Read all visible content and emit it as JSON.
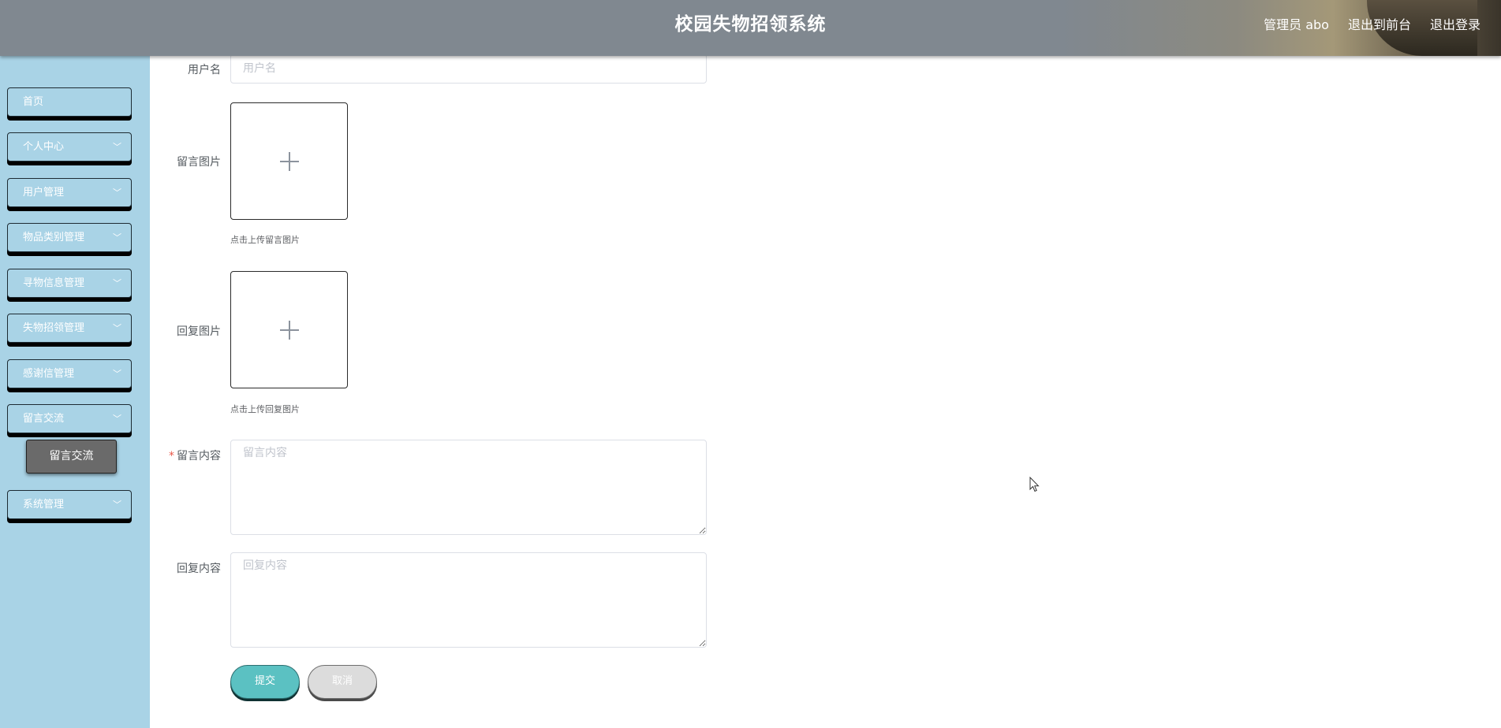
{
  "header": {
    "title": "校园失物招领系统",
    "admin_label": "管理员 abo",
    "front_link": "退出到前台",
    "logout_link": "退出登录"
  },
  "sidebar": {
    "items": [
      {
        "label": "首页",
        "has_chevron": false
      },
      {
        "label": "个人中心",
        "has_chevron": true
      },
      {
        "label": "用户管理",
        "has_chevron": true
      },
      {
        "label": "物品类别管理",
        "has_chevron": true
      },
      {
        "label": "寻物信息管理",
        "has_chevron": true
      },
      {
        "label": "失物招领管理",
        "has_chevron": true
      },
      {
        "label": "感谢信管理",
        "has_chevron": true
      },
      {
        "label": "留言交流",
        "has_chevron": true
      },
      {
        "label": "系统管理",
        "has_chevron": true
      }
    ],
    "active_submenu": "留言交流",
    "chevron_glyph": "﹀"
  },
  "form": {
    "username_label": "用户名",
    "username_placeholder": "用户名",
    "message_image_label": "留言图片",
    "message_image_hint": "点击上传留言图片",
    "reply_image_label": "回复图片",
    "reply_image_hint": "点击上传回复图片",
    "required_mark": "*",
    "message_content_label": "留言内容",
    "message_content_placeholder": "留言内容",
    "reply_content_label": "回复内容",
    "reply_content_placeholder": "回复内容",
    "submit_label": "提交",
    "cancel_label": "取消"
  }
}
